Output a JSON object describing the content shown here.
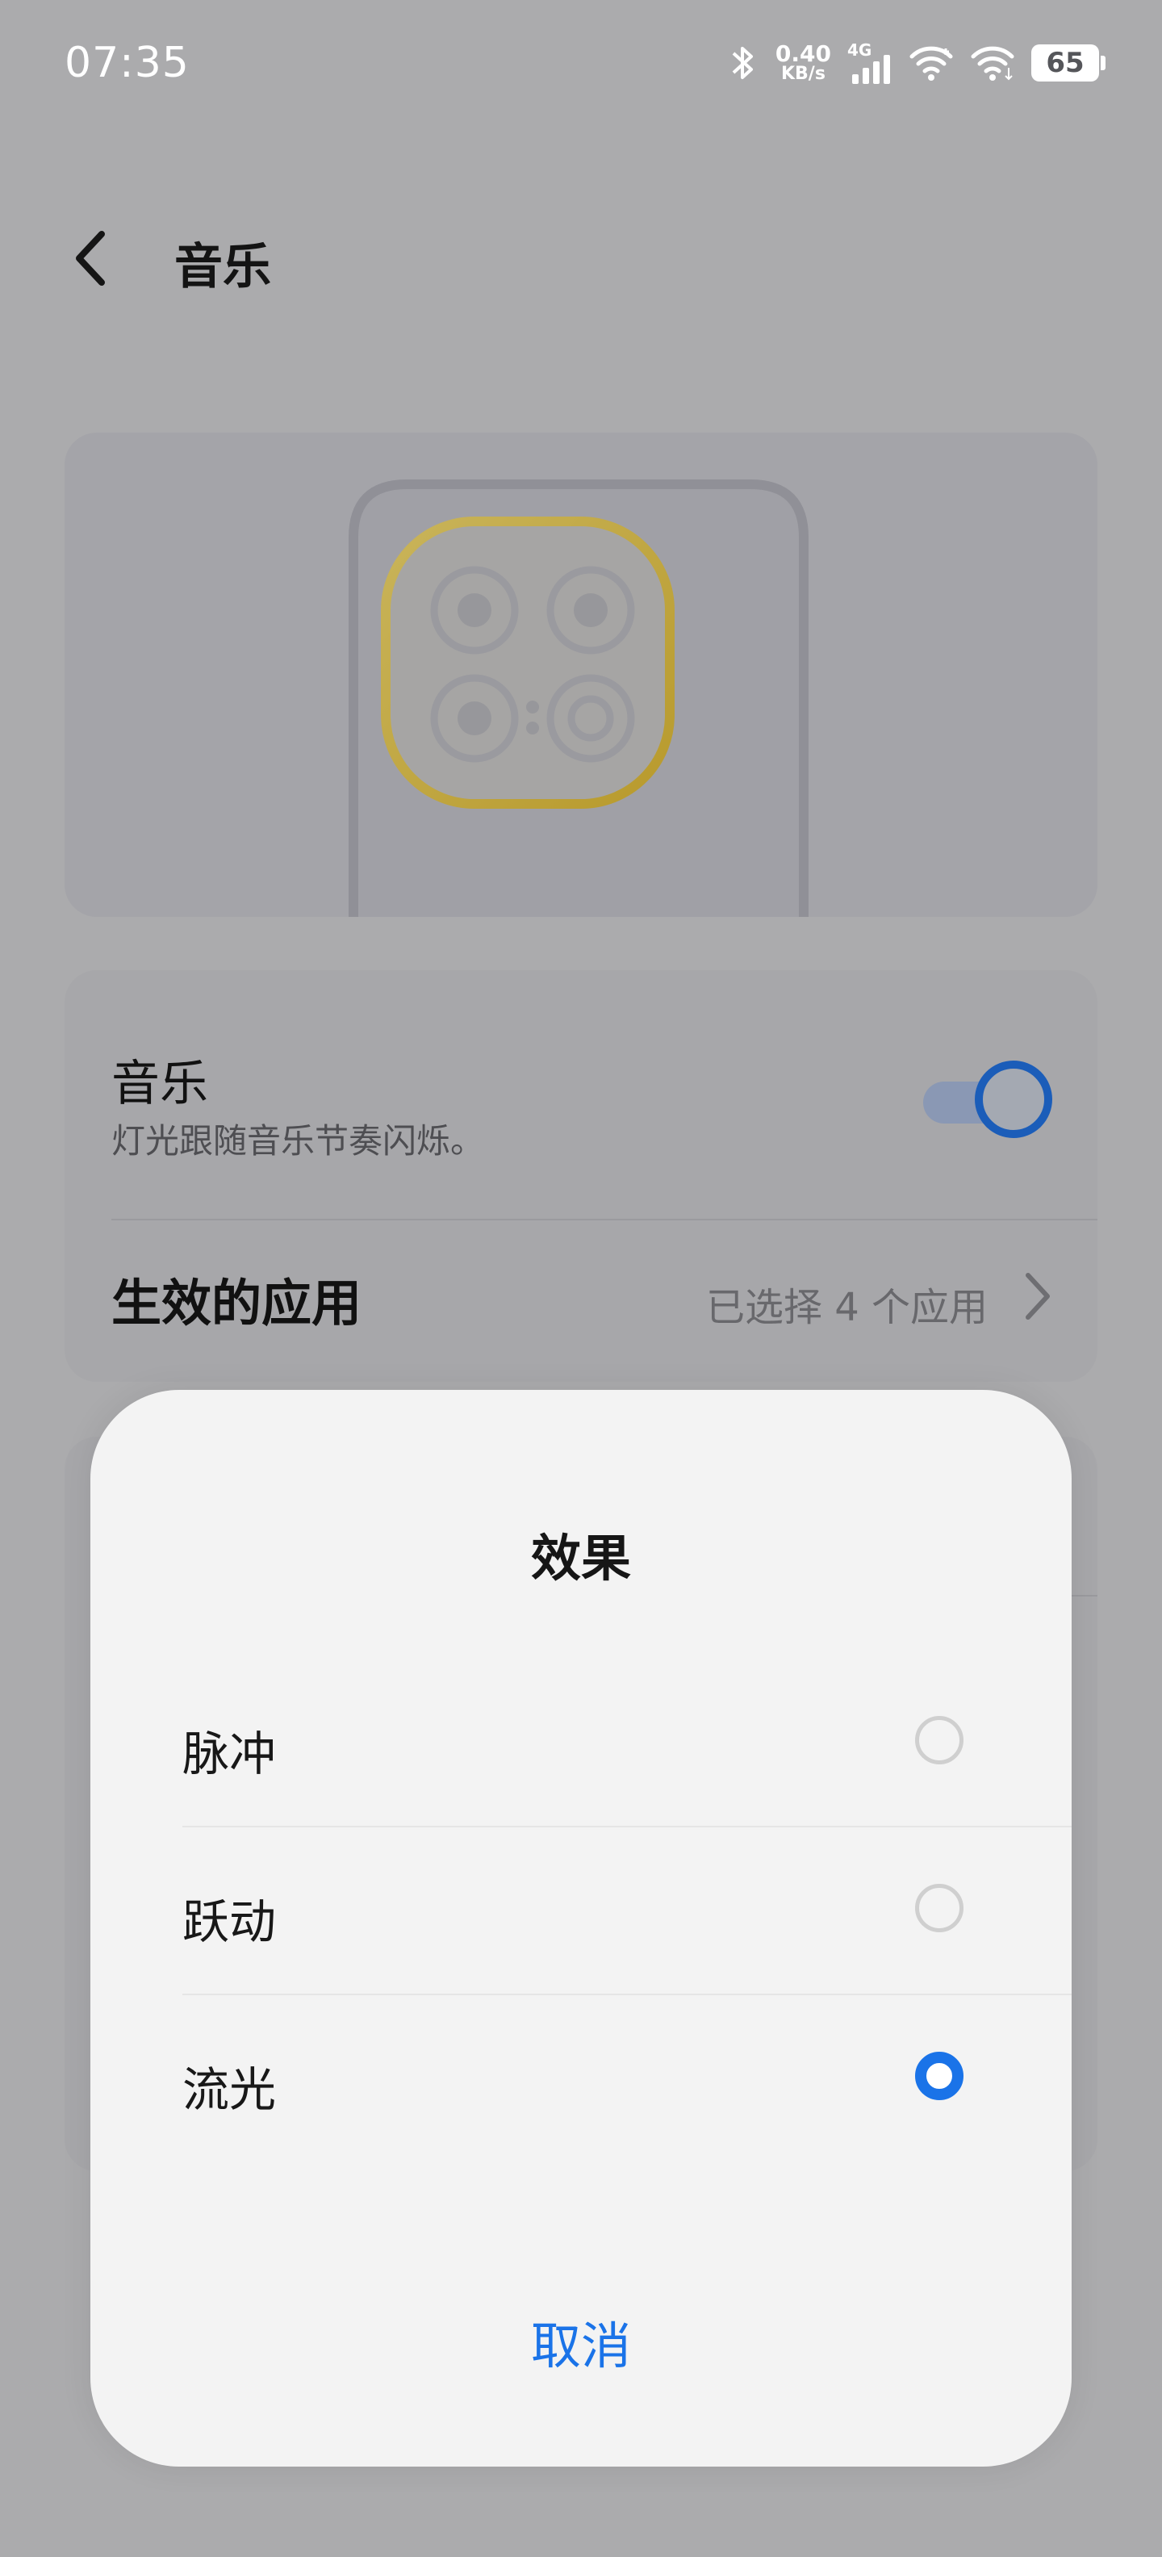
{
  "status_bar": {
    "time": "07:35",
    "speed_value": "0.40",
    "speed_unit": "KB/s",
    "network": "4G",
    "battery": "65",
    "icons": [
      "bluetooth-icon",
      "cell-signal-icon",
      "wifi-icon",
      "wifi-icon"
    ]
  },
  "header": {
    "title": "音乐",
    "back_icon": "back-arrow-icon"
  },
  "music_setting": {
    "title": "音乐",
    "subtitle": "灯光跟随音乐节奏闪烁。",
    "enabled": true
  },
  "apps_setting": {
    "title": "生效的应用",
    "value": "已选择 4 个应用"
  },
  "dialog": {
    "title": "效果",
    "options": [
      {
        "label": "脉冲",
        "selected": false
      },
      {
        "label": "跃动",
        "selected": false
      },
      {
        "label": "流光",
        "selected": true
      }
    ],
    "cancel": "取消"
  },
  "colors": {
    "accent": "#1a73e8",
    "scrim": "#ababad",
    "dialog_bg": "#f3f3f3",
    "ring": "#c9a93e"
  }
}
